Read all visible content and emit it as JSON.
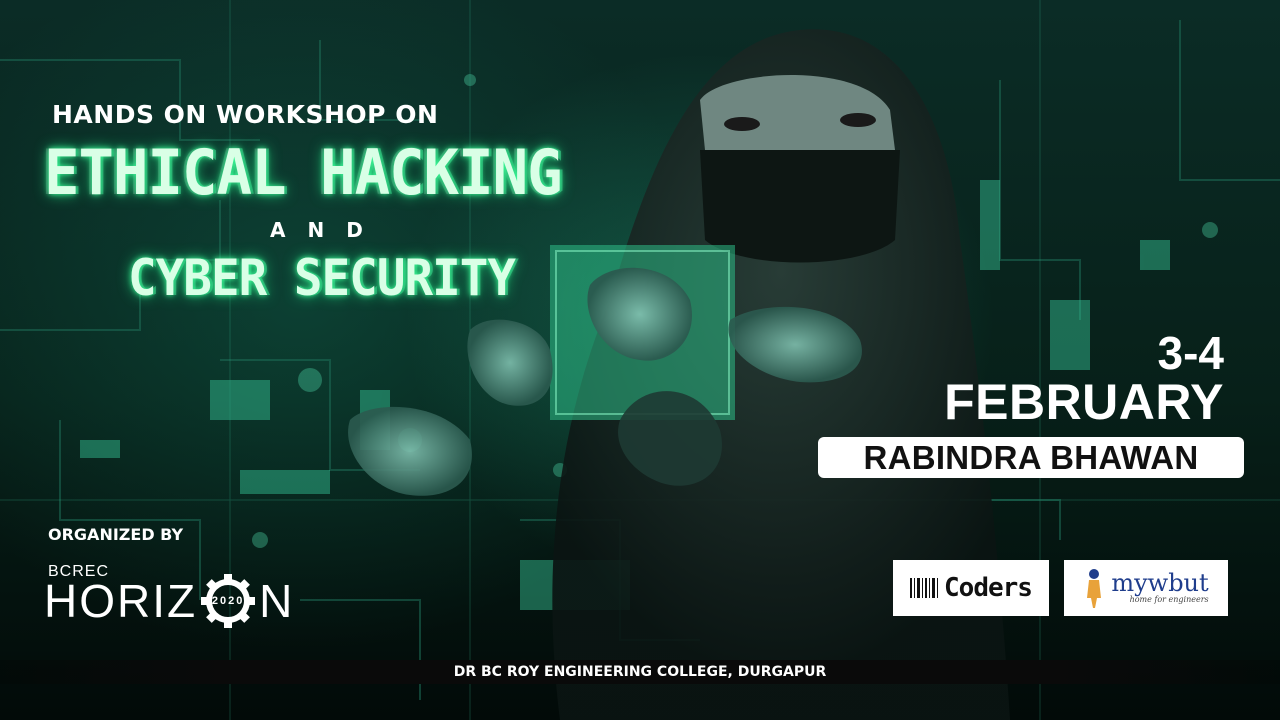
{
  "event": {
    "subtitle": "HANDS ON WORKSHOP ON",
    "title_line1": "ETHICAL HACKING",
    "title_connector": "AND",
    "title_line2": "CYBER SECURITY"
  },
  "schedule": {
    "days": "3-4",
    "month": "FEBRUARY",
    "venue": "RABINDRA BHAWAN"
  },
  "organizer": {
    "label": "ORGANIZED BY",
    "brand_small": "BCREC",
    "brand_big_start": "HORIZ",
    "brand_big_end": "N",
    "brand_year": "2020"
  },
  "sponsors": [
    {
      "name": "Coders",
      "icon": "barcode-icon"
    },
    {
      "name": "mywbut",
      "tagline": "home for engineers",
      "icon": "figure-icon"
    }
  ],
  "footer": {
    "text": "DR BC ROY ENGINEERING COLLEGE, DURGAPUR"
  },
  "colors": {
    "accent_green": "#3dff9a",
    "background": "#04120f",
    "white": "#ffffff"
  }
}
